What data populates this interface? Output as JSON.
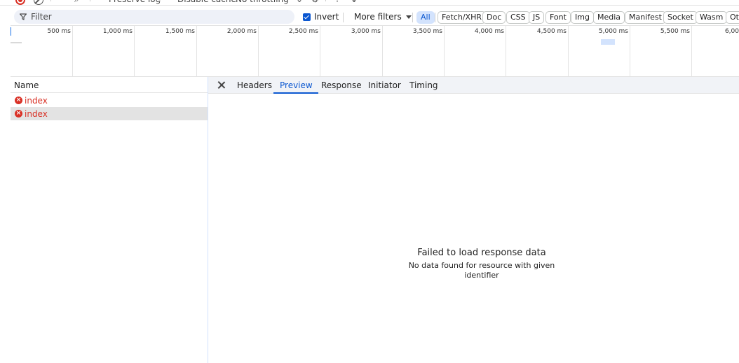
{
  "toolbar": {
    "preserve_log_label": "Preserve log",
    "disable_cache_label": "Disable cache",
    "throttling_value": "No throttling"
  },
  "filter": {
    "placeholder": "Filter",
    "invert_label": "Invert",
    "invert_checked": true,
    "more_filters_label": "More filters",
    "chips": [
      {
        "label": "All",
        "active": true
      },
      {
        "label": "Fetch/XHR",
        "active": false
      },
      {
        "label": "Doc",
        "active": false
      },
      {
        "label": "CSS",
        "active": false
      },
      {
        "label": "JS",
        "active": false
      },
      {
        "label": "Font",
        "active": false
      },
      {
        "label": "Img",
        "active": false
      },
      {
        "label": "Media",
        "active": false
      },
      {
        "label": "Manifest",
        "active": false
      },
      {
        "label": "Socket",
        "active": false
      },
      {
        "label": "Wasm",
        "active": false
      },
      {
        "label": "Ot",
        "active": false
      }
    ]
  },
  "timeline": {
    "ticks": [
      "500 ms",
      "1,000 ms",
      "1,500 ms",
      "2,000 ms",
      "2,500 ms",
      "3,000 ms",
      "3,500 ms",
      "4,000 ms",
      "4,500 ms",
      "5,000 ms",
      "5,500 ms",
      "6,00"
    ]
  },
  "requests": {
    "column_header": "Name",
    "items": [
      {
        "name": "index",
        "status": "error",
        "selected": false
      },
      {
        "name": "index",
        "status": "error",
        "selected": true
      }
    ]
  },
  "details": {
    "tabs": [
      {
        "label": "Headers",
        "active": false
      },
      {
        "label": "Preview",
        "active": true
      },
      {
        "label": "Response",
        "active": false
      },
      {
        "label": "Initiator",
        "active": false
      },
      {
        "label": "Timing",
        "active": false
      }
    ],
    "empty_title": "Failed to load response data",
    "empty_message": "No data found for resource with given identifier"
  },
  "colors": {
    "accent": "#0b57d0",
    "error": "#d93025",
    "chip_active_bg": "#d3e3fd"
  }
}
